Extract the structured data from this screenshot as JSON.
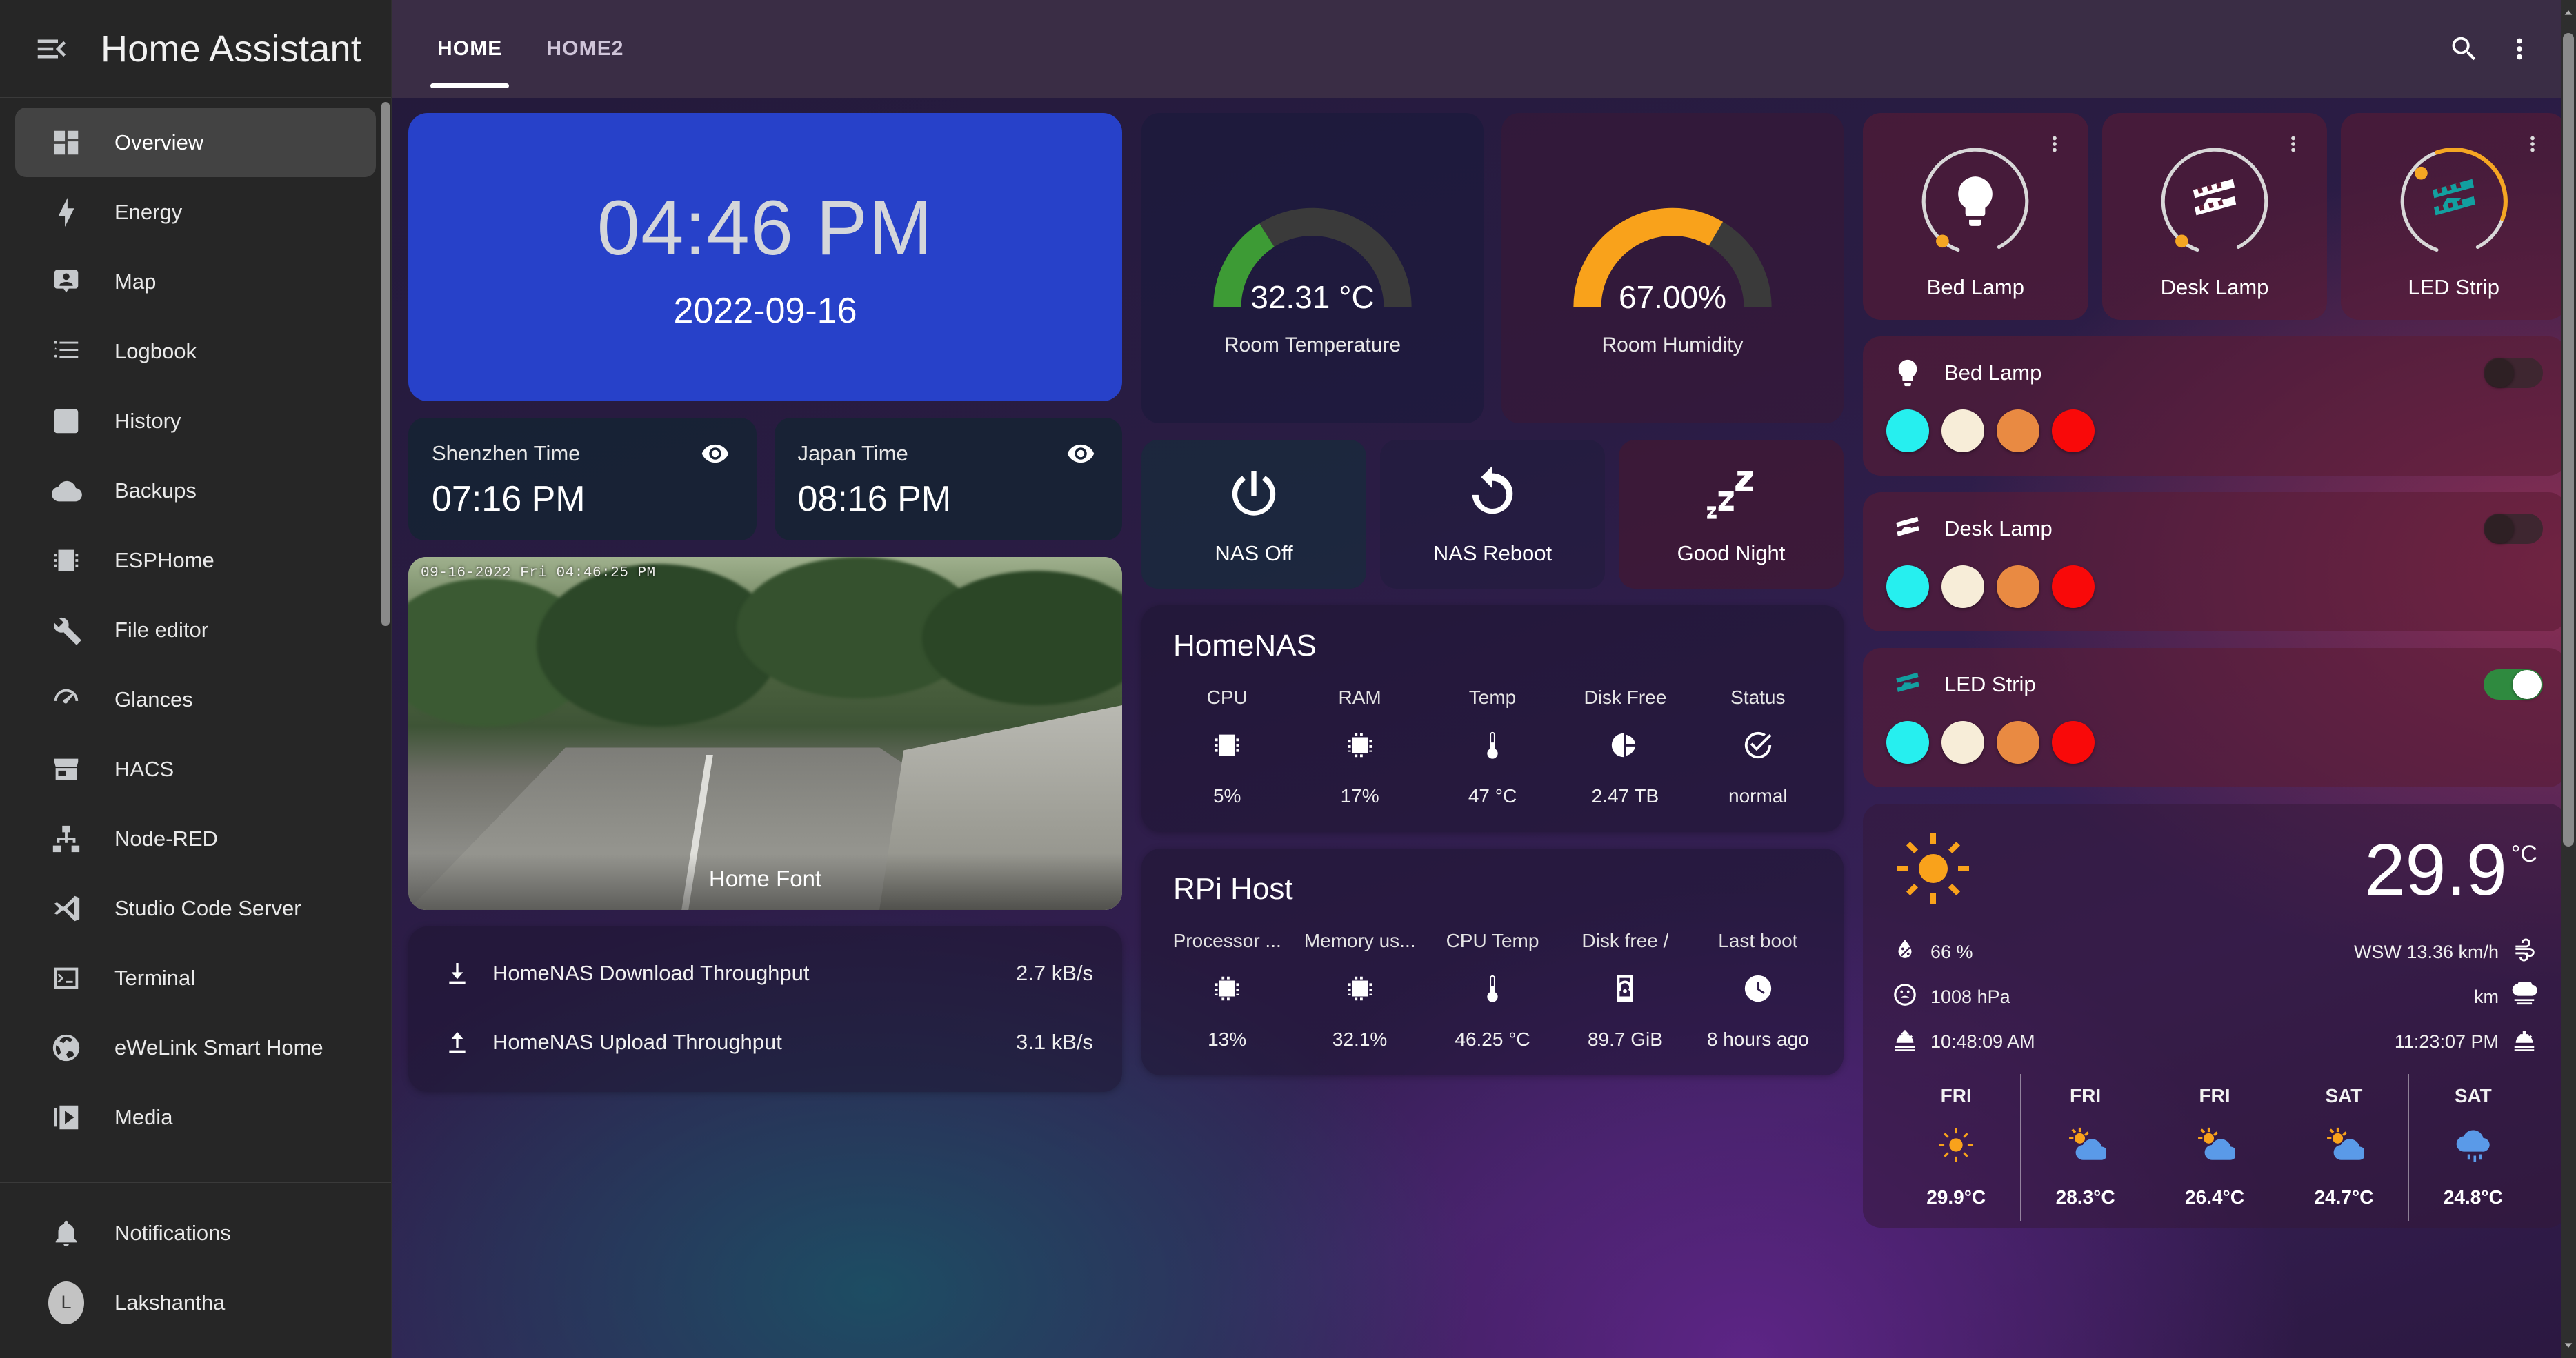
{
  "sidebar": {
    "title": "Home Assistant",
    "menu_icon": "hamburger-collapse-icon",
    "items": [
      {
        "label": "Overview",
        "icon": "view-dashboard-icon",
        "active": true
      },
      {
        "label": "Energy",
        "icon": "lightning-bolt-icon",
        "active": false
      },
      {
        "label": "Map",
        "icon": "map-marker-account-icon",
        "active": false
      },
      {
        "label": "Logbook",
        "icon": "format-list-bulleted-icon",
        "active": false
      },
      {
        "label": "History",
        "icon": "chart-box-icon",
        "active": false
      },
      {
        "label": "Backups",
        "icon": "cloud-icon",
        "active": false
      },
      {
        "label": "ESPHome",
        "icon": "chip-icon",
        "active": false
      },
      {
        "label": "File editor",
        "icon": "wrench-icon",
        "active": false
      },
      {
        "label": "Glances",
        "icon": "gauge-icon",
        "active": false
      },
      {
        "label": "HACS",
        "icon": "store-icon",
        "active": false
      },
      {
        "label": "Node-RED",
        "icon": "sitemap-icon",
        "active": false
      },
      {
        "label": "Studio Code Server",
        "icon": "vscode-icon",
        "active": false
      },
      {
        "label": "Terminal",
        "icon": "console-icon",
        "active": false
      },
      {
        "label": "eWeLink Smart Home",
        "icon": "web-icon",
        "active": false
      },
      {
        "label": "Media",
        "icon": "play-box-multiple-icon",
        "active": false
      }
    ],
    "footer": [
      {
        "label": "Notifications",
        "icon": "bell-icon"
      },
      {
        "label": "Lakshantha",
        "icon": "avatar",
        "initial": "L"
      }
    ]
  },
  "topbar": {
    "tabs": [
      {
        "label": "HOME",
        "active": true
      },
      {
        "label": "HOME2",
        "active": false
      }
    ],
    "search_icon": "search-icon",
    "menu_icon": "dots-vertical-icon"
  },
  "clock": {
    "time": "04:46 PM",
    "date": "2022-09-16"
  },
  "world_clocks": [
    {
      "name": "Shenzhen Time",
      "value": "07:16 PM",
      "icon": "eye-icon"
    },
    {
      "name": "Japan Time",
      "value": "08:16 PM",
      "icon": "eye-icon"
    }
  ],
  "camera": {
    "timestamp": "09-16-2022 Fri 04:46:25 PM",
    "label": "Home Font"
  },
  "throughput": [
    {
      "name": "HomeNAS Download Throughput",
      "value": "2.7 kB/s",
      "icon": "download-icon"
    },
    {
      "name": "HomeNAS Upload Throughput",
      "value": "3.1 kB/s",
      "icon": "upload-icon"
    }
  ],
  "gauges": [
    {
      "name": "Room Temperature",
      "value": "32.31 °C",
      "percent": 32,
      "color": "#3d9b35"
    },
    {
      "name": "Room Humidity",
      "value": "67.00%",
      "percent": 67,
      "color": "#f9a21b"
    }
  ],
  "actions": [
    {
      "label": "NAS Off",
      "icon": "power-icon"
    },
    {
      "label": "NAS Reboot",
      "icon": "restart-icon"
    },
    {
      "label": "Good Night",
      "icon": "sleep-zzz-icon"
    }
  ],
  "homenas": {
    "title": "HomeNAS",
    "columns": [
      {
        "header": "CPU",
        "icon": "memory-chip-icon",
        "value": "5%"
      },
      {
        "header": "RAM",
        "icon": "chip-icon",
        "value": "17%"
      },
      {
        "header": "Temp",
        "icon": "thermometer-icon",
        "value": "47 °C"
      },
      {
        "header": "Disk Free",
        "icon": "harddisk-pie-icon",
        "value": "2.47 TB"
      },
      {
        "header": "Status",
        "icon": "check-circle-icon",
        "value": "normal"
      }
    ]
  },
  "rpihost": {
    "title": "RPi Host",
    "columns": [
      {
        "header": "Processor ...",
        "icon": "cpu-64-bit-icon",
        "value": "13%"
      },
      {
        "header": "Memory us...",
        "icon": "chip-icon",
        "value": "32.1%"
      },
      {
        "header": "CPU Temp",
        "icon": "thermometer-icon",
        "value": "46.25 °C"
      },
      {
        "header": "Disk free /",
        "icon": "harddisk-icon",
        "value": "89.7 GiB"
      },
      {
        "header": "Last boot",
        "icon": "clock-icon",
        "value": "8 hours ago"
      }
    ]
  },
  "light_buttons": [
    {
      "name": "Bed Lamp",
      "icon": "lightbulb-icon",
      "on": false,
      "accent": "#ffffff"
    },
    {
      "name": "Desk Lamp",
      "icon": "led-strip-icon",
      "on": false,
      "accent": "#ffffff"
    },
    {
      "name": "LED Strip",
      "icon": "led-strip-variant-icon",
      "on": true,
      "accent": "#12a0a0"
    }
  ],
  "light_rows": [
    {
      "name": "Bed Lamp",
      "icon": "lightbulb-icon",
      "on": false,
      "icon_color": "#ffffff",
      "swatches": [
        "#26efef",
        "#f7edd8",
        "#e98a42",
        "#f90909"
      ]
    },
    {
      "name": "Desk Lamp",
      "icon": "led-strip-icon",
      "on": false,
      "icon_color": "#ffffff",
      "swatches": [
        "#26efef",
        "#f7edd8",
        "#e98a42",
        "#f90909"
      ]
    },
    {
      "name": "LED Strip",
      "icon": "led-strip-variant-icon",
      "on": true,
      "icon_color": "#12a0a0",
      "swatches": [
        "#26efef",
        "#f7edd8",
        "#e98a42",
        "#f90909"
      ]
    }
  ],
  "weather": {
    "condition_icon": "sunny-icon",
    "temperature": "29.9",
    "unit": "°C",
    "humidity": "66 %",
    "pressure": "1008 hPa",
    "sunrise": "10:48:09 AM",
    "wind": "WSW 13.36 km/h",
    "visibility": "km",
    "sunset": "11:23:07 PM",
    "humidity_icon": "water-percent-icon",
    "pressure_icon": "gauge-low-icon",
    "sunrise_icon": "weather-sunset-up-icon",
    "wind_icon": "weather-windy-icon",
    "visibility_icon": "weather-fog-icon",
    "sunset_icon": "weather-sunset-down-icon",
    "forecast": [
      {
        "day": "FRI",
        "icon": "sunny-icon",
        "temp": "29.9°C"
      },
      {
        "day": "FRI",
        "icon": "partly-cloudy-icon",
        "temp": "28.3°C"
      },
      {
        "day": "FRI",
        "icon": "partly-cloudy-icon",
        "temp": "26.4°C"
      },
      {
        "day": "SAT",
        "icon": "partly-cloudy-icon",
        "temp": "24.7°C"
      },
      {
        "day": "SAT",
        "icon": "rainy-icon",
        "temp": "24.8°C"
      }
    ]
  },
  "colors": {
    "accent_blue": "#2741c9",
    "gauge_green": "#3d9b35",
    "gauge_orange": "#f9a21b",
    "toggle_on": "#2f8a3f",
    "sun_orange": "#f9a21b",
    "cloud_blue": "#5a9ae8",
    "led_teal": "#12a0a0"
  }
}
